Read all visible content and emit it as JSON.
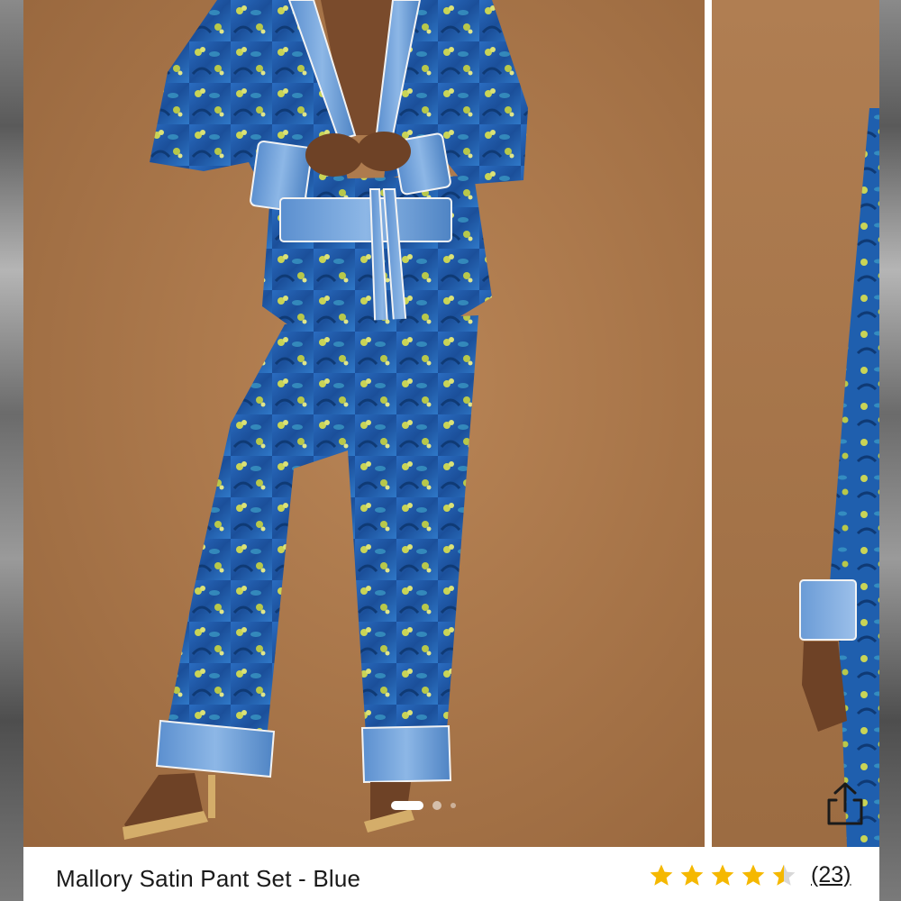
{
  "product": {
    "title": "Mallory Satin Pant Set - Blue",
    "rating": 4.5,
    "rating_max": 5,
    "review_count": "(23)"
  },
  "carousel": {
    "image_count": 3,
    "active_index": 0,
    "image_description": "Model wearing blue peacock-print satin pajama jacket and wide-leg pants on a tan background",
    "share_icon": "share-icon"
  },
  "colors": {
    "star": "#f5b800",
    "star_empty": "#d8d8d8",
    "backdrop": "#a9764b",
    "fabric": "#1f5fae",
    "fabric_light": "#6fa2d8",
    "accent_print": "#c9d456"
  }
}
